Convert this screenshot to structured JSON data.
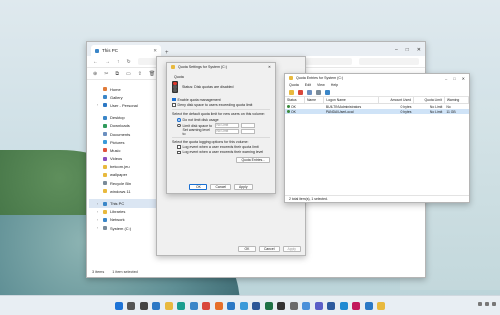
{
  "explorer": {
    "tab_title": "This PC",
    "nav_items": [
      {
        "label": "Home",
        "icon": "home-icon",
        "color": "#e07b39"
      },
      {
        "label": "Gallery",
        "icon": "gallery-icon",
        "color": "#3a86c8"
      },
      {
        "label": "User - Personal",
        "icon": "cloud-icon",
        "color": "#2b78c5",
        "chevron": true
      },
      {
        "label": "Desktop",
        "icon": "desktop-icon",
        "color": "#3a86c8",
        "gap_before": true
      },
      {
        "label": "Downloads",
        "icon": "download-icon",
        "color": "#2f9a5b"
      },
      {
        "label": "Documents",
        "icon": "document-icon",
        "color": "#6b8fbf"
      },
      {
        "label": "Pictures",
        "icon": "picture-icon",
        "color": "#3a9ad9"
      },
      {
        "label": "Music",
        "icon": "music-icon",
        "color": "#e0533d"
      },
      {
        "label": "Videos",
        "icon": "video-icon",
        "color": "#8a4fc2"
      },
      {
        "label": "betcom.jeu",
        "icon": "folder-icon",
        "color": "#e8b93e"
      },
      {
        "label": "wallpaper",
        "icon": "folder-icon",
        "color": "#e8b93e"
      },
      {
        "label": "Recycle Bin",
        "icon": "recycle-bin-icon",
        "color": "#7a8b99"
      },
      {
        "label": "windows 11",
        "icon": "folder-icon",
        "color": "#e8b93e"
      },
      {
        "label": "This PC",
        "icon": "pc-icon",
        "color": "#3a86c8",
        "selected": true,
        "chevron": true,
        "gap_before": true
      },
      {
        "label": "Libraries",
        "icon": "library-icon",
        "color": "#e8b93e",
        "chevron": true
      },
      {
        "label": "Network",
        "icon": "network-icon",
        "color": "#3a86c8",
        "chevron": true
      },
      {
        "label": "System (C:)",
        "icon": "drive-icon",
        "color": "#7a8b99",
        "chevron": true
      }
    ],
    "status_items": "3 items",
    "status_selected": "1 item selected"
  },
  "props_dialog": {
    "ok": "OK",
    "cancel": "Cancel",
    "apply": "Apply"
  },
  "quota_dialog": {
    "title": "Quota Settings for System (C:)",
    "tab": "Quota",
    "status": "Status:  Disk quotas are disabled",
    "enable": "Enable quota management",
    "deny": "Deny disk space to users exceeding quota limit",
    "default_heading": "Select the default quota limit for new users on this volume:",
    "no_limit": "Do not limit disk usage",
    "limit_to": "Limit disk space to",
    "warning_level": "Set warning level to",
    "no_limit_box": "No Limit",
    "logging_heading": "Select the quota logging options for this volume:",
    "log_exceed": "Log event when a user exceeds their quota limit",
    "log_warning": "Log event when a user exceeds their warning level",
    "entries_btn": "Quota Entries...",
    "ok": "OK",
    "cancel": "Cancel",
    "apply": "Apply"
  },
  "entries_window": {
    "title": "Quota Entries for System (C:)",
    "menu": [
      "Quota",
      "Edit",
      "View",
      "Help"
    ],
    "columns": [
      "Status",
      "Name",
      "Logon Name",
      "Amount Used",
      "Quota Limit",
      "Warning"
    ],
    "rows": [
      {
        "status": "OK",
        "name": "",
        "logon": "BUILTIN\\Administrators",
        "used": "0 bytes",
        "limit": "No Limit",
        "warning": "No",
        "selected": false
      },
      {
        "status": "OK",
        "name": "",
        "logon": "PANDA\\UserLocal",
        "used": "0 bytes",
        "limit": "No Limit",
        "warning": "11 GB",
        "selected": true
      }
    ],
    "status": "2 total item(s), 1 selected."
  },
  "taskbar": {
    "icons": [
      {
        "name": "start-icon",
        "color": "#1d73d6"
      },
      {
        "name": "search-icon",
        "color": "#555555"
      },
      {
        "name": "task-view-icon",
        "color": "#444444"
      },
      {
        "name": "widgets-icon",
        "color": "#2b78c5"
      },
      {
        "name": "file-explorer-icon",
        "color": "#e8b93e"
      },
      {
        "name": "edge-icon",
        "color": "#1a9e8f"
      },
      {
        "name": "store-icon",
        "color": "#3a86c8"
      },
      {
        "name": "chrome-icon",
        "color": "#d9473b"
      },
      {
        "name": "firefox-icon",
        "color": "#e66f2a"
      },
      {
        "name": "mail-icon",
        "color": "#2b78c5"
      },
      {
        "name": "photos-icon",
        "color": "#3a9ad9"
      },
      {
        "name": "word-icon",
        "color": "#2b5797"
      },
      {
        "name": "excel-icon",
        "color": "#1e7145"
      },
      {
        "name": "terminal-icon",
        "color": "#333333"
      },
      {
        "name": "settings-icon",
        "color": "#6b6b6b"
      },
      {
        "name": "notepad-icon",
        "color": "#4a90d9"
      },
      {
        "name": "teams-icon",
        "color": "#5b5fc7"
      },
      {
        "name": "powershell-icon",
        "color": "#2c5a9e"
      },
      {
        "name": "vscode-icon",
        "color": "#1f8ad2"
      },
      {
        "name": "snipping-icon",
        "color": "#c2185b"
      },
      {
        "name": "calendar-icon",
        "color": "#2b78c5"
      },
      {
        "name": "store-bag-icon",
        "color": "#e8b93e"
      }
    ]
  }
}
